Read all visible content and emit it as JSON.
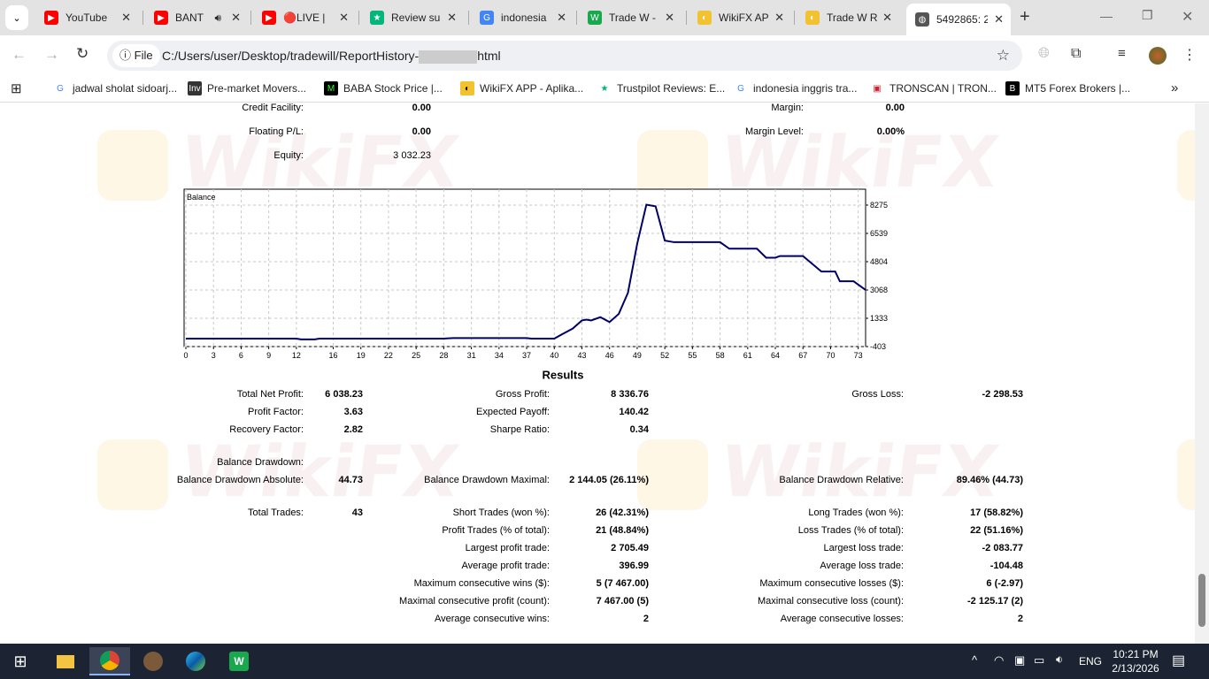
{
  "browser": {
    "tabs": [
      {
        "title": "YouTube",
        "icon": "youtube-icon",
        "color": "#ff0000"
      },
      {
        "title": "BANT",
        "icon": "youtube-icon",
        "color": "#ff0000",
        "audio": true
      },
      {
        "title": "🔴LIVE | ",
        "icon": "youtube-icon",
        "color": "#ff0000"
      },
      {
        "title": "Review su",
        "icon": "trustpilot-star-icon",
        "color": "#00b67a"
      },
      {
        "title": "indonesia",
        "icon": "google-icon",
        "color": "#4285f4"
      },
      {
        "title": "Trade W -",
        "icon": "tradew-icon",
        "color": "#1aa84f"
      },
      {
        "title": "WikiFX AP",
        "icon": "wikifx-icon",
        "color": "#f2c230"
      },
      {
        "title": "Trade W R",
        "icon": "wikifx-icon",
        "color": "#f2c230"
      },
      {
        "title": "5492865: 2",
        "icon": "globe-icon",
        "color": "#555555",
        "active": true
      }
    ],
    "url_scheme": "File",
    "url": "C:/Users/user/Desktop/tradewill/ReportHistory-",
    "url_suffix": "html",
    "bookmarks": [
      {
        "label": "jadwal sholat sidoarj...",
        "icon": "google-icon"
      },
      {
        "label": "Pre-market Movers...",
        "icon": "investing-icon"
      },
      {
        "label": "BABA Stock Price |...",
        "icon": "marketwatch-icon"
      },
      {
        "label": "WikiFX APP - Aplika...",
        "icon": "wikifx-icon"
      },
      {
        "label": "Trustpilot Reviews: E...",
        "icon": "trustpilot-star-icon"
      },
      {
        "label": "indonesia inggris tra...",
        "icon": "google-icon"
      },
      {
        "label": "TRONSCAN | TRON...",
        "icon": "tronscan-icon"
      },
      {
        "label": "MT5 Forex Brokers |...",
        "icon": "brokers-icon"
      }
    ]
  },
  "summary": {
    "credit_facility": {
      "label": "Credit Facility:",
      "value": "0.00"
    },
    "floating": {
      "label": "Floating P/L:",
      "value": "0.00"
    },
    "equity": {
      "label": "Equity:",
      "value": "3 032.23"
    },
    "margin": {
      "label": "Margin:",
      "value": "0.00"
    },
    "margin_level": {
      "label": "Margin Level:",
      "value": "0.00%"
    }
  },
  "chart_data": {
    "type": "line",
    "title": "Balance",
    "x_ticks": [
      0,
      3,
      6,
      9,
      12,
      16,
      19,
      22,
      25,
      28,
      31,
      34,
      37,
      40,
      43,
      46,
      49,
      52,
      55,
      58,
      61,
      64,
      67,
      70,
      73
    ],
    "y_ticks": [
      8275,
      6539,
      4804,
      3068,
      1333,
      -403
    ],
    "xlim": [
      0,
      73.8
    ],
    "ylim": [
      -403,
      9250
    ],
    "grid": true,
    "line_color": "#000066",
    "x": [
      0,
      12,
      12.5,
      14,
      14.5,
      28,
      29,
      37,
      37.5,
      40,
      41,
      42,
      43,
      43.5,
      44,
      45,
      46,
      47,
      48,
      49,
      50,
      51,
      52,
      53,
      58,
      59,
      62,
      63,
      64,
      64.5,
      67,
      69,
      70.5,
      71,
      72.5,
      73.8
    ],
    "y": [
      85,
      85,
      40,
      40,
      85,
      85,
      120,
      120,
      85,
      85,
      400,
      700,
      1200,
      1250,
      1200,
      1400,
      1100,
      1600,
      2900,
      5900,
      8300,
      8200,
      6100,
      6000,
      6000,
      5600,
      5600,
      5050,
      5050,
      5150,
      5150,
      4200,
      4200,
      3600,
      3600,
      3068
    ]
  },
  "results": {
    "title": "Results",
    "rows": [
      {
        "label": "Total Net Profit:",
        "value": "6 038.23",
        "col": 1,
        "row": 0
      },
      {
        "label": "Gross Profit:",
        "value": "8 336.76",
        "col": 2,
        "row": 0
      },
      {
        "label": "Gross Loss:",
        "value": "-2 298.53",
        "col": 3,
        "row": 0
      },
      {
        "label": "Profit Factor:",
        "value": "3.63",
        "col": 1,
        "row": 1
      },
      {
        "label": "Expected Payoff:",
        "value": "140.42",
        "col": 2,
        "row": 1
      },
      {
        "label": "Recovery Factor:",
        "value": "2.82",
        "col": 1,
        "row": 2
      },
      {
        "label": "Sharpe Ratio:",
        "value": "0.34",
        "col": 2,
        "row": 2
      },
      {
        "label": "Balance Drawdown:",
        "value": "",
        "col": 1,
        "row": 3
      },
      {
        "label": "Balance Drawdown Absolute:",
        "value": "44.73",
        "col": 1,
        "row": 4
      },
      {
        "label": "Balance Drawdown Maximal:",
        "value": "2 144.05 (26.11%)",
        "col": 2,
        "row": 4
      },
      {
        "label": "Balance Drawdown Relative:",
        "value": "89.46% (44.73)",
        "col": 3,
        "row": 4
      },
      {
        "label": "Total Trades:",
        "value": "43",
        "col": 1,
        "row": 5
      },
      {
        "label": "Short Trades (won %):",
        "value": "26 (42.31%)",
        "col": 2,
        "row": 5
      },
      {
        "label": "Long Trades (won %):",
        "value": "17 (58.82%)",
        "col": 3,
        "row": 5
      },
      {
        "label": "Profit Trades (% of total):",
        "value": "21 (48.84%)",
        "col": 2,
        "row": 6
      },
      {
        "label": "Loss Trades (% of total):",
        "value": "22 (51.16%)",
        "col": 3,
        "row": 6
      },
      {
        "label": "Largest profit trade:",
        "value": "2 705.49",
        "col": 2,
        "row": 7
      },
      {
        "label": "Largest loss trade:",
        "value": "-2 083.77",
        "col": 3,
        "row": 7
      },
      {
        "label": "Average profit trade:",
        "value": "396.99",
        "col": 2,
        "row": 8
      },
      {
        "label": "Average loss trade:",
        "value": "-104.48",
        "col": 3,
        "row": 8
      },
      {
        "label": "Maximum consecutive wins ($):",
        "value": "5 (7 467.00)",
        "col": 2,
        "row": 9
      },
      {
        "label": "Maximum consecutive losses ($):",
        "value": "6 (-2.97)",
        "col": 3,
        "row": 9
      },
      {
        "label": "Maximal consecutive profit (count):",
        "value": "7 467.00 (5)",
        "col": 2,
        "row": 10
      },
      {
        "label": "Maximal consecutive loss (count):",
        "value": "-2 125.17 (2)",
        "col": 3,
        "row": 10
      },
      {
        "label": "Average consecutive wins:",
        "value": "2",
        "col": 2,
        "row": 11
      },
      {
        "label": "Average consecutive losses:",
        "value": "2",
        "col": 3,
        "row": 11
      }
    ]
  },
  "watermark": "WikiFX",
  "taskbar": {
    "language": "ENG",
    "time": "10:21 PM",
    "date": "2/13/2026"
  }
}
